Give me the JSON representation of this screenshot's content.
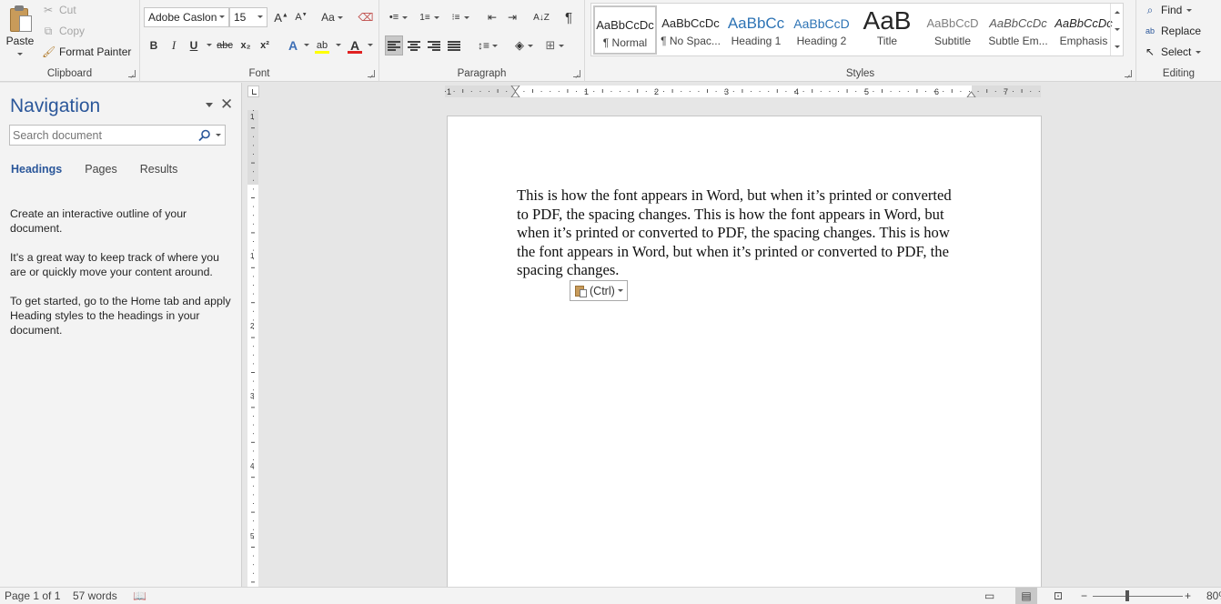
{
  "ribbon": {
    "clipboard": {
      "paste": "Paste",
      "cut": "Cut",
      "copy": "Copy",
      "format_painter": "Format Painter",
      "group_label": "Clipboard"
    },
    "font": {
      "font_name": "Adobe Caslon",
      "font_size": "15",
      "change_case": "Aa",
      "bold": "B",
      "italic": "I",
      "underline": "U",
      "strikethrough": "abc",
      "subscript": "x₂",
      "superscript": "x²",
      "group_label": "Font",
      "highlight_color": "#ffff00",
      "font_color": "#e02020"
    },
    "paragraph": {
      "group_label": "Paragraph",
      "show_marks": "¶"
    },
    "styles": {
      "group_label": "Styles",
      "items": [
        {
          "sample": "AaBbCcDc",
          "name": "¶ Normal"
        },
        {
          "sample": "AaBbCcDc",
          "name": "¶ No Spac..."
        },
        {
          "sample": "AaBbCc",
          "name": "Heading 1"
        },
        {
          "sample": "AaBbCcD",
          "name": "Heading 2"
        },
        {
          "sample": "AaB",
          "name": "Title"
        },
        {
          "sample": "AaBbCcD",
          "name": "Subtitle"
        },
        {
          "sample": "AaBbCcDc",
          "name": "Subtle Em..."
        },
        {
          "sample": "AaBbCcDc",
          "name": "Emphasis"
        }
      ]
    },
    "editing": {
      "find": "Find",
      "replace": "Replace",
      "select": "Select",
      "group_label": "Editing"
    }
  },
  "navigation": {
    "title": "Navigation",
    "search_placeholder": "Search document",
    "tabs": [
      "Headings",
      "Pages",
      "Results"
    ],
    "help": [
      "Create an interactive outline of your document.",
      "It's a great way to keep track of where you are or quickly move your content around.",
      "To get started, go to the Home tab and apply Heading styles to the headings in your document."
    ]
  },
  "ruler": {
    "h_labels": [
      "1",
      "1",
      "2",
      "3",
      "4",
      "5",
      "6",
      "7"
    ],
    "v_labels": [
      "1",
      "1",
      "2",
      "3",
      "4",
      "5"
    ]
  },
  "document": {
    "body_text": "This is how the font appears in Word, but when it’s printed or converted to PDF, the spacing changes. This is how the font appears in Word, but when it’s printed or converted to PDF, the spacing changes. This is how the font appears in Word, but when it’s printed or converted to PDF, the spacing changes.",
    "paste_options_label": "(Ctrl)"
  },
  "status_bar": {
    "page": "Page 1 of 1",
    "words": "57 words",
    "zoom": "80%"
  },
  "colors": {
    "accent": "#2b579a",
    "ribbon_bg": "#f3f3f3",
    "canvas_bg": "#e6e6e6"
  }
}
